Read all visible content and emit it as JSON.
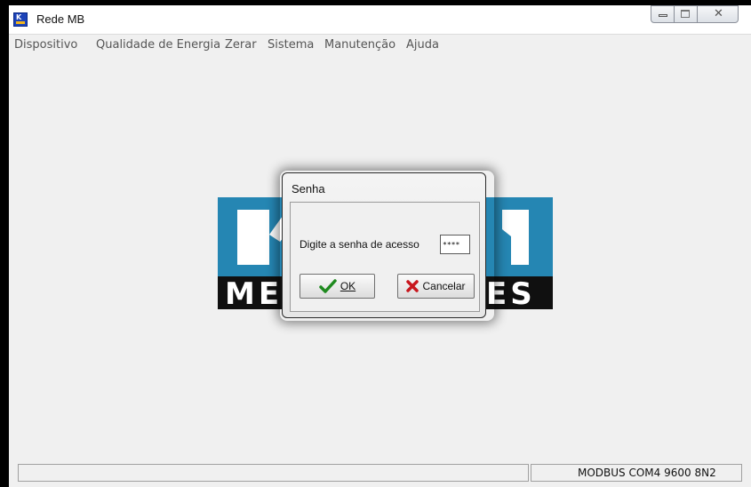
{
  "window": {
    "title": "Rede MB"
  },
  "menu": {
    "items": [
      "Dispositivo",
      "Qualidade de Energia",
      "Zerar",
      "Sistema",
      "Manutenção",
      "Ajuda"
    ]
  },
  "logo": {
    "colors": {
      "blue": "#2586b3",
      "dark": "#101010",
      "white": "#ffffff"
    }
  },
  "dialog": {
    "title": "Senha",
    "label": "Digite a senha de acesso",
    "password_value": "****",
    "ok_label": "OK",
    "cancel_label": "Cancelar",
    "ok_icon": "check-icon",
    "cancel_icon": "x-icon"
  },
  "status_bar": {
    "connection": "MODBUS COM4 9600 8N2"
  }
}
